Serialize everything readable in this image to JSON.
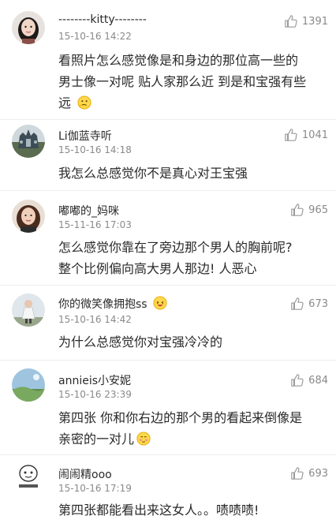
{
  "comments": [
    {
      "username": "--------kitty--------",
      "timestamp": "15-10-16 14:22",
      "likes": "1391",
      "lines": [
        "看照片怎么感觉像是和身边的那位高一些的",
        "男士像一对呢 贴人家那么近 到是和宝强有些",
        "远"
      ],
      "emoji": "thinking-emoji-icon"
    },
    {
      "username": "Li伽蓝寺听",
      "timestamp": "15-10-16 14:18",
      "likes": "1041",
      "lines": [
        "我怎么总感觉你不是真心对王宝强"
      ]
    },
    {
      "username": "嘟嘟的_妈咪",
      "timestamp": "15-11-16 17:03",
      "likes": "965",
      "lines": [
        "怎么感觉你靠在了旁边那个男人的胸前呢?",
        "整个比例偏向高大男人那边! 人恶心"
      ]
    },
    {
      "username": "你的微笑像拥抱ss",
      "timestamp": "15-10-16 14:42",
      "likes": "673",
      "lines": [
        "为什么总感觉你对宝强冷冷的"
      ]
    },
    {
      "username": "annieis小安妮",
      "timestamp": "15-10-16 23:39",
      "likes": "684",
      "lines": [
        "第四张 你和你右边的那个男的看起来倒像是",
        "亲密的一对儿"
      ],
      "emoji": "shy-emoji-icon"
    },
    {
      "username": "闹闹精ooo",
      "timestamp": "15-10-16 17:19",
      "likes": "693",
      "lines": [
        "第四张都能看出来这女人。。啧啧啧!"
      ]
    }
  ],
  "colors": {
    "text": "#2a2a2a",
    "meta": "#8a8a8a",
    "divider": "#ededed",
    "background": "#ffffff"
  },
  "icons": {
    "like": "thumbs-up-icon"
  }
}
